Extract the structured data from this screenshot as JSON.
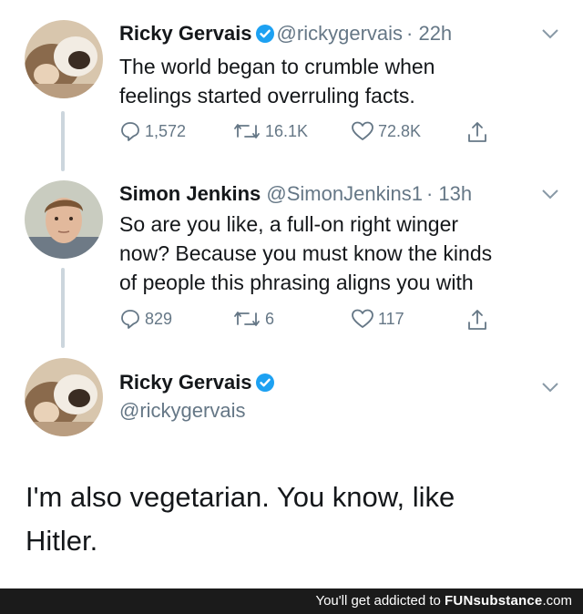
{
  "tweets": [
    {
      "name": "Ricky Gervais",
      "handle": "@rickygervais",
      "time": "· 22h",
      "text_lines": [
        "The world began to crumble when",
        "feelings started overruling facts."
      ],
      "replies": "1,572",
      "retweets": "16.1K",
      "likes": "72.8K"
    },
    {
      "name": "Simon Jenkins",
      "handle": "@SimonJenkins1",
      "time": "· 13h",
      "text_lines": [
        "So are you like, a full-on right winger",
        "now? Because you must know the kinds",
        "of people this phrasing aligns you with"
      ],
      "replies": "829",
      "retweets": "6",
      "likes": "117"
    },
    {
      "name": "Ricky Gervais",
      "handle": "@rickygervais",
      "text_lines": [
        "I'm also vegetarian. You know, like",
        "Hitler."
      ]
    }
  ],
  "icons": {
    "reply": "reply-icon",
    "retweet": "retweet-icon",
    "like": "heart-icon",
    "share": "share-icon",
    "verified": "verified-badge-icon",
    "menu": "chevron-down-icon"
  },
  "colors": {
    "verified": "#1da1f2",
    "muted": "#657786",
    "text": "#14171a",
    "thread_line": "#ccd6dd",
    "footer_bg": "#1b1b1b"
  },
  "footer": {
    "prefix": "You'll get addicted to ",
    "brand": "FUNsubstance",
    "suffix": ".com"
  }
}
